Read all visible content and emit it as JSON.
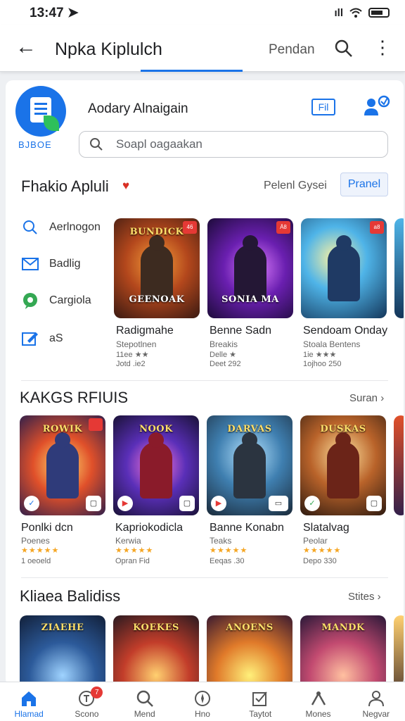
{
  "status_bar": {
    "time": "13:47",
    "signal": "ıll"
  },
  "app_bar": {
    "back_icon": "arrow-left-icon",
    "title": "Npka Kiplulch",
    "tab_label": "Pendan",
    "search_icon": "search-icon",
    "more_icon": "more-vert-icon"
  },
  "account": {
    "logo_caption": "BJBOE",
    "name": "Aodary Alnaigain",
    "fn_label": "Fil",
    "person_icon": "person-add-icon"
  },
  "search": {
    "placeholder": "Soapl oagaakan"
  },
  "section1": {
    "title": "Fhakio Apluli",
    "subtitle": "Pelenl Gysei",
    "button": "Pranel",
    "side_items": [
      {
        "label": "Aerlnogon",
        "icon": "search-icon"
      },
      {
        "label": "Badlig",
        "icon": "mail-icon"
      },
      {
        "label": "Cargiola",
        "icon": "chat-icon"
      },
      {
        "label": "aS",
        "icon": "edit-icon"
      }
    ],
    "games": [
      {
        "banner": "BUNDICK",
        "caption": "GEENOAK",
        "badge": "46",
        "name": "Radigmahe",
        "sub": "Stepotlnen",
        "line2": "11ee ★★",
        "meta": "Jotd .ie2"
      },
      {
        "banner": "",
        "caption": "SONIA MA",
        "badge": "Ä8",
        "name": "Benne Sadn",
        "sub": "Breakis",
        "line2": "Delle ★",
        "meta": "Deet 292"
      },
      {
        "banner": "",
        "caption": "",
        "badge": "a8",
        "name": "Sendoam Onday",
        "sub": "Stoala Bentens",
        "line2": "1ie ★★★",
        "meta": "1ojhoo 250"
      }
    ]
  },
  "section2": {
    "title": "KAKGS RFIUIS",
    "link": "Suran ›",
    "games": [
      {
        "banner": "ROWIK",
        "name": "Ponlki dcn",
        "sub": "Poenes",
        "stars": "★★★★★",
        "meta": "1 oeoeld"
      },
      {
        "banner": "NOOK",
        "name": "Kapriokodicla",
        "sub": "Kerwia",
        "stars": "★★★★★",
        "meta": "Opran Fid"
      },
      {
        "banner": "DARVAS",
        "name": "Banne Konabn",
        "sub": "Teaks",
        "stars": "★★★★★",
        "meta": "Eeqas .30"
      },
      {
        "banner": "DUSKAS",
        "name": "Slatalvag",
        "sub": "Peolar",
        "stars": "★★★★★",
        "meta": "Depo 330"
      }
    ]
  },
  "section3": {
    "title": "Kliaea Balidiss",
    "link": "Stites ›",
    "banners": [
      "ZIAEHE",
      "KOEKES",
      "ANOENS",
      "MANDK"
    ]
  },
  "bottom_nav": [
    {
      "label": "Hlamad",
      "icon": "home-icon"
    },
    {
      "label": "Scono",
      "icon": "grid-icon",
      "badge": "7"
    },
    {
      "label": "Mend",
      "icon": "search-icon"
    },
    {
      "label": "Hno",
      "icon": "compass-icon"
    },
    {
      "label": "Taytot",
      "icon": "checkbox-icon"
    },
    {
      "label": "Mones",
      "icon": "tools-icon"
    },
    {
      "label": "Negvar",
      "icon": "person-icon"
    }
  ],
  "colors": {
    "accent": "#1a73e8",
    "heart": "#d93025",
    "star": "#f5a623",
    "badge": "#e53935"
  }
}
